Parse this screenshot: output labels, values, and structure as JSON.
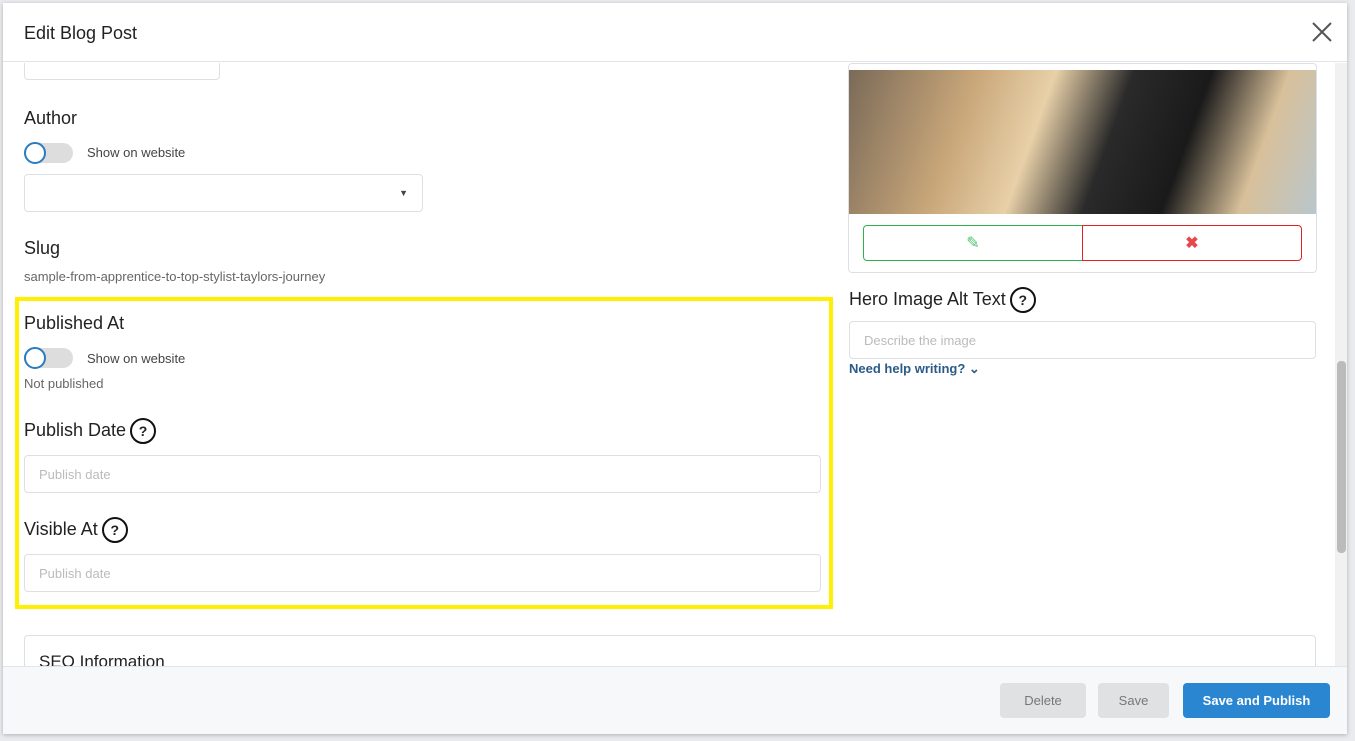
{
  "header": {
    "title": "Edit Blog Post"
  },
  "author": {
    "label": "Author",
    "toggle_label": "Show on website",
    "select_value": ""
  },
  "slug": {
    "label": "Slug",
    "value": "sample-from-apprentice-to-top-stylist-taylors-journey"
  },
  "published_at": {
    "label": "Published At",
    "toggle_label": "Show on website",
    "status": "Not published"
  },
  "publish_date": {
    "label": "Publish Date",
    "placeholder": "Publish date",
    "help": "?"
  },
  "visible_at": {
    "label": "Visible At",
    "placeholder": "Publish date",
    "help": "?"
  },
  "hero": {
    "alt_label": "Hero Image Alt Text",
    "help": "?",
    "alt_placeholder": "Describe the image",
    "help_link": "Need help writing?"
  },
  "seo": {
    "title": "SEO Information"
  },
  "footer": {
    "delete": "Delete",
    "save": "Save",
    "save_publish": "Save and Publish"
  },
  "colors": {
    "primary": "#2a86d1",
    "highlight": "#ffef00"
  }
}
